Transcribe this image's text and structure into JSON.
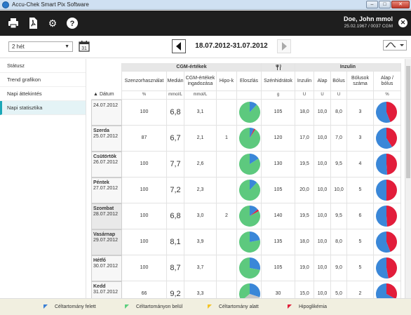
{
  "window": {
    "title": "Accu-Chek Smart Pix Software",
    "min_glyph": "–",
    "max_glyph": "□",
    "close_glyph": "✕"
  },
  "toolbar": {
    "icons": [
      "print-icon",
      "pdf-icon",
      "settings-icon",
      "help-icon"
    ],
    "help_glyph": "?",
    "gear_glyph": "⚙"
  },
  "user": {
    "name": "Doe, John mmol",
    "info": "25.02.1967 / 0037 CGM",
    "close_glyph": "✕"
  },
  "nav": {
    "period": "2 hét",
    "calendar_day": "31",
    "date_range": "18.07.2012-31.07.2012"
  },
  "sidebar": {
    "items": [
      {
        "label": "Státusz",
        "active": false
      },
      {
        "label": "Trend grafikon",
        "active": false
      },
      {
        "label": "Napi áttekintés",
        "active": false
      },
      {
        "label": "Napi statisztika",
        "active": true
      }
    ]
  },
  "table": {
    "groups": {
      "cgm": "CGM-értékek",
      "carb_icon": "fork-knife-icon",
      "insulin": "Inzulin"
    },
    "date_header": "Dátum",
    "sort_glyph": "▲",
    "columns": [
      {
        "label": "Szenzorhasználat",
        "unit": "%"
      },
      {
        "label": "Medián",
        "unit": "mmol/L"
      },
      {
        "label": "CGM-értékek ingadozása",
        "unit": "mmol/L"
      },
      {
        "label": "Hipo-k",
        "unit": ""
      },
      {
        "label": "Eloszlás",
        "unit": ""
      },
      {
        "label": "Szénhidrátok",
        "unit": "g"
      },
      {
        "label": "Inzulin",
        "unit": "U"
      },
      {
        "label": "Alap",
        "unit": "U"
      },
      {
        "label": "Bólus",
        "unit": "U"
      },
      {
        "label": "Bólusok száma",
        "unit": ""
      },
      {
        "label": "Alap / bólus",
        "unit": "%"
      }
    ],
    "rows": [
      {
        "day": "",
        "date": "24.07.2012",
        "weekend": false,
        "sensor": "100",
        "median": "6,8",
        "median_flag": "",
        "variability": "3,1",
        "hypos": "",
        "dist_blue": 0.12,
        "dist_red": 0.0,
        "carbs": "105",
        "insulin": "18,0",
        "basal": "10,0",
        "bolus": "8,0",
        "bolus_count": "3",
        "ratio_blue": 0.56
      },
      {
        "day": "Szerda",
        "date": "25.07.2012",
        "weekend": false,
        "sensor": "87",
        "median": "6,7",
        "median_flag": "green",
        "variability": "2,1",
        "hypos": "1",
        "dist_blue": 0.07,
        "dist_red": 0.02,
        "carbs": "120",
        "insulin": "17,0",
        "basal": "10,0",
        "bolus": "7,0",
        "bolus_count": "3",
        "ratio_blue": 0.59
      },
      {
        "day": "Csütörtök",
        "date": "26.07.2012",
        "weekend": false,
        "sensor": "100",
        "median": "7,7",
        "median_flag": "green",
        "variability": "2,6",
        "hypos": "",
        "dist_blue": 0.16,
        "dist_red": 0.0,
        "carbs": "130",
        "insulin": "19,5",
        "basal": "10,0",
        "bolus": "9,5",
        "bolus_count": "4",
        "ratio_blue": 0.51
      },
      {
        "day": "Péntek",
        "date": "27.07.2012",
        "weekend": false,
        "sensor": "100",
        "median": "7,2",
        "median_flag": "green",
        "variability": "2,3",
        "hypos": "",
        "dist_blue": 0.12,
        "dist_red": 0.0,
        "carbs": "105",
        "insulin": "20,0",
        "basal": "10,0",
        "bolus": "10,0",
        "bolus_count": "5",
        "ratio_blue": 0.5
      },
      {
        "day": "Szombat",
        "date": "28.07.2012",
        "weekend": true,
        "sensor": "100",
        "median": "6,8",
        "median_flag": "green",
        "variability": "3,0",
        "hypos": "2",
        "dist_blue": 0.14,
        "dist_red": 0.03,
        "carbs": "140",
        "insulin": "19,5",
        "basal": "10,0",
        "bolus": "9,5",
        "bolus_count": "6",
        "ratio_blue": 0.51
      },
      {
        "day": "Vasárnap",
        "date": "29.07.2012",
        "weekend": true,
        "sensor": "100",
        "median": "8,1",
        "median_flag": "green",
        "variability": "3,9",
        "hypos": "",
        "dist_blue": 0.22,
        "dist_red": 0.0,
        "carbs": "135",
        "insulin": "18,0",
        "basal": "10,0",
        "bolus": "8,0",
        "bolus_count": "5",
        "ratio_blue": 0.56
      },
      {
        "day": "Hétfő",
        "date": "30.07.2012",
        "weekend": false,
        "sensor": "100",
        "median": "8,7",
        "median_flag": "green",
        "variability": "3,7",
        "hypos": "",
        "dist_blue": 0.28,
        "dist_red": 0.0,
        "carbs": "105",
        "insulin": "19,0",
        "basal": "10,0",
        "bolus": "9,0",
        "bolus_count": "5",
        "ratio_blue": 0.53
      },
      {
        "day": "Kedd",
        "date": "31.07.2012",
        "weekend": false,
        "sensor": "66",
        "median": "9,2",
        "median_flag": "blue",
        "variability": "3,3",
        "hypos": "",
        "dist_blue": 0.3,
        "dist_red": 0.0,
        "dist_gray": 0.34,
        "carbs": "30",
        "insulin": "15,0",
        "basal": "10,0",
        "bolus": "5,0",
        "bolus_count": "2",
        "ratio_blue": 0.67
      }
    ]
  },
  "legend": [
    {
      "label": "Céltartomány felett",
      "color": "#3a7fd5"
    },
    {
      "label": "Céltartományon belül",
      "color": "#5ccf7e"
    },
    {
      "label": "Céltartomány alatt",
      "color": "#f4c325"
    },
    {
      "label": "Hipoglikémia",
      "color": "#e0203a"
    }
  ],
  "colors": {
    "blue": "#3a87d8",
    "green": "#5dc97e",
    "red": "#e21d3b",
    "gray": "#c6c6c6",
    "accent": "#1aa7b7"
  }
}
